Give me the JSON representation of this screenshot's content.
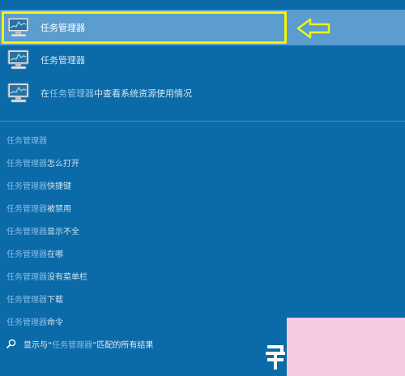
{
  "top_result": {
    "label": "任务管理器",
    "icon": "task-manager-icon",
    "highlight_color": "#f5f500",
    "arrow_icon": "left-arrow-icon"
  },
  "apps": [
    {
      "label": "任务管理器",
      "icon": "task-manager-icon"
    },
    {
      "label_prefix": "在",
      "label_match": "任务管理器",
      "label_suffix": "中查看系统资源使用情况",
      "icon": "task-manager-icon"
    }
  ],
  "suggestions": [
    {
      "match": "任务管理器",
      "rest": ""
    },
    {
      "match": "任务管理器",
      "rest": "怎么打开"
    },
    {
      "match": "任务管理器",
      "rest": "快捷键"
    },
    {
      "match": "任务管理器",
      "rest": "被禁用"
    },
    {
      "match": "任务管理器",
      "rest": "显示不全"
    },
    {
      "match": "任务管理器",
      "rest": "在哪"
    },
    {
      "match": "任务管理器",
      "rest": "没有菜单栏"
    },
    {
      "match": "任务管理器",
      "rest": "下载"
    },
    {
      "match": "任务管理器",
      "rest": "命令"
    }
  ],
  "search_all": {
    "prefix": "显示与“",
    "match": "任务管理器",
    "suffix": "”匹配的所有结果",
    "icon": "search-icon"
  },
  "colors": {
    "background": "#0b6aa8",
    "selected_row": "#5a9dce",
    "watermark": "#f5cbe3"
  }
}
